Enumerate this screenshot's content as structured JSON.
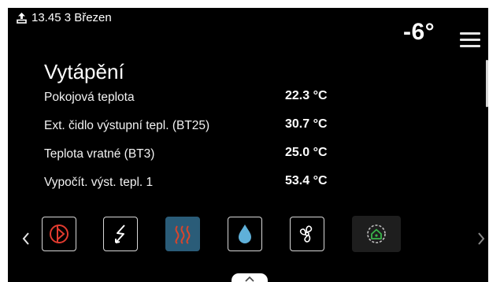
{
  "status": {
    "datetime": "13.45 3 Březen",
    "outdoor_temp": "-6°"
  },
  "page": {
    "title": "Vytápění"
  },
  "readings": [
    {
      "label": "Pokojová teplota",
      "value": "22.3 °C"
    },
    {
      "label": "Ext. čidlo výstupní tepl. (BT25)",
      "value": "30.7 °C"
    },
    {
      "label": "Teplota vratné (BT3)",
      "value": "25.0 °C"
    },
    {
      "label": "Vypočít. výst. tepl. 1",
      "value": "53.4 °C"
    }
  ],
  "icons": {
    "upload": "upload-icon",
    "menu": "hamburger-menu-icon",
    "left": "chevron-left-icon",
    "right": "chevron-right-icon",
    "tiles": [
      "power-operating-mode-icon",
      "electric-addition-icon",
      "heating-icon",
      "hot-water-icon",
      "ventilation-fan-icon",
      "smart-home-cycle-icon"
    ],
    "handle": "chevron-up-icon"
  },
  "colors": {
    "screen_bg": "#000000",
    "active_tile": "#2a5c78",
    "heating_accent": "#d9452b",
    "power_accent": "#e23b2f",
    "water_accent": "#5fb0d9",
    "smart_home_accent": "#39b54a"
  }
}
